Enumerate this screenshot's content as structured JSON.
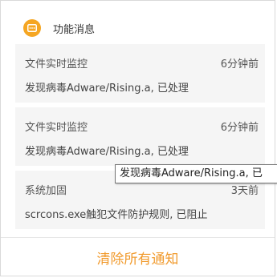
{
  "header": {
    "title": "功能消息",
    "icon": "message-icon",
    "accent": "#f5a623"
  },
  "notifications": [
    {
      "title": "文件实时监控",
      "time": "6分钟前",
      "desc": "发现病毒Adware/Rising.a, 已处理"
    },
    {
      "title": "文件实时监控",
      "time": "6分钟前",
      "desc": "发现病毒Adware/Rising.a, 已处理"
    },
    {
      "title": "系统加固",
      "time": "3天前",
      "desc": "scrcons.exe触犯文件防护规则, 已阻止"
    }
  ],
  "footer": {
    "clear_label": "清除所有通知",
    "clear_color": "#f19a2c"
  },
  "tooltip": {
    "text": "发现病毒Adware/Rising.a, 已"
  }
}
